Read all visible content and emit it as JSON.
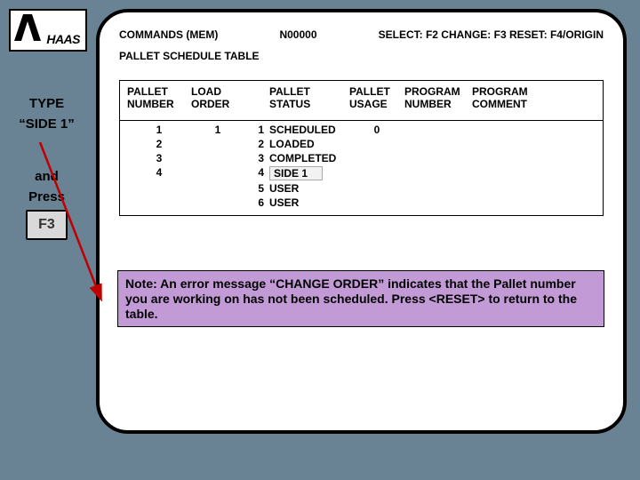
{
  "logo_text": "HAAS",
  "sidebar": {
    "type_label": "TYPE",
    "type_value": "“SIDE 1”",
    "and_label": "and",
    "press_label": "Press",
    "key_label": "F3"
  },
  "panel": {
    "header_left": "COMMANDS (MEM)",
    "header_mid": "N00000",
    "header_right": "SELECT: F2  CHANGE: F3  RESET: F4/ORIGIN",
    "subtitle": "PALLET SCHEDULE TABLE"
  },
  "columns": {
    "c1a": "PALLET",
    "c1b": "NUMBER",
    "c2a": "LOAD",
    "c2b": "ORDER",
    "c3a": "PALLET",
    "c3b": "STATUS",
    "c4a": "PALLET",
    "c4b": "USAGE",
    "c5a": "PROGRAM",
    "c5b": "NUMBER",
    "c6a": "PROGRAM",
    "c6b": "COMMENT"
  },
  "rows": [
    {
      "pallet": "1",
      "load": "1",
      "sn": "1",
      "status": "SCHEDULED",
      "usage": "0"
    },
    {
      "pallet": "2",
      "load": "",
      "sn": "2",
      "status": "LOADED",
      "usage": ""
    },
    {
      "pallet": "3",
      "load": "",
      "sn": "3",
      "status": "COMPLETED",
      "usage": ""
    },
    {
      "pallet": "4",
      "load": "",
      "sn": "4",
      "status": "SIDE 1",
      "usage": "",
      "highlight": true
    },
    {
      "pallet": "",
      "load": "",
      "sn": "5",
      "status": "USER",
      "usage": ""
    },
    {
      "pallet": "",
      "load": "",
      "sn": "6",
      "status": "USER",
      "usage": ""
    }
  ],
  "note": "Note:  An error message “CHANGE ORDER” indicates that the Pallet number you are working on has not been scheduled.  Press <RESET> to return to the table."
}
